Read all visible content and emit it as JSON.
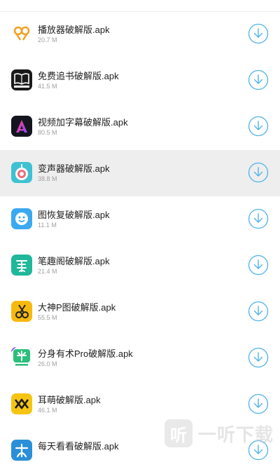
{
  "accent_color": "#4fb3ea",
  "apps": [
    {
      "name": "播放器破解版.apk",
      "size": "20.7 M",
      "icon": "player-icon"
    },
    {
      "name": "免费追书破解版.apk",
      "size": "41.5 M",
      "icon": "book-icon"
    },
    {
      "name": "视频加字幕破解版.apk",
      "size": "80.5 M",
      "icon": "video-subtitle-icon"
    },
    {
      "name": "变声器破解版.apk",
      "size": "38.8 M",
      "icon": "voice-changer-icon"
    },
    {
      "name": "图恢复破解版.apk",
      "size": "11.1 M",
      "icon": "photo-recovery-icon"
    },
    {
      "name": "笔趣阁破解版.apk",
      "size": "21.4 M",
      "icon": "biquge-icon"
    },
    {
      "name": "大神P图破解版.apk",
      "size": "55.5 M",
      "icon": "photo-edit-icon"
    },
    {
      "name": "分身有术Pro破解版.apk",
      "size": "26.0 M",
      "icon": "app-clone-icon"
    },
    {
      "name": "耳萌破解版.apk",
      "size": "46.1 M",
      "icon": "ermeng-icon"
    },
    {
      "name": "每天看看破解版.apk",
      "size": "",
      "icon": "daily-watch-icon"
    }
  ],
  "watermark": {
    "text": "一听下载",
    "badge": "听"
  }
}
